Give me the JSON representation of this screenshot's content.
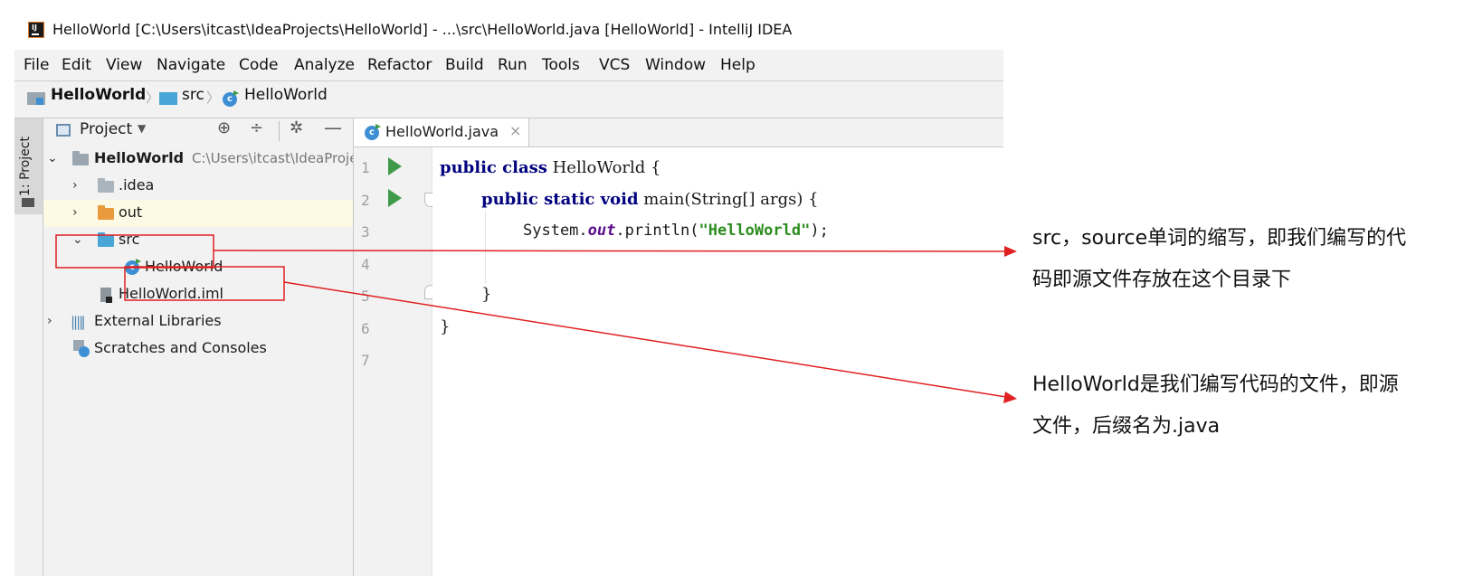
{
  "window": {
    "title": "HelloWorld [C:\\Users\\itcast\\IdeaProjects\\HelloWorld] - ...\\src\\HelloWorld.java [HelloWorld] - IntelliJ IDEA"
  },
  "menu": [
    "File",
    "Edit",
    "View",
    "Navigate",
    "Code",
    "Analyze",
    "Refactor",
    "Build",
    "Run",
    "Tools",
    "VCS",
    "Window",
    "Help"
  ],
  "breadcrumb": {
    "project": "HelloWorld",
    "folder": "src",
    "file": "HelloWorld"
  },
  "sidebar": {
    "tab_label": "1: Project"
  },
  "project_panel": {
    "title": "Project",
    "tree": {
      "root_name": "HelloWorld",
      "root_path": "C:\\Users\\itcast\\IdeaProjects\\HelloWorld",
      "idea": ".idea",
      "out": "out",
      "src": "src",
      "class_file": "HelloWorld",
      "iml": "HelloWorld.iml",
      "ext_libs": "External Libraries",
      "scratches": "Scratches and Consoles"
    }
  },
  "editor": {
    "tab_label": "HelloWorld.java",
    "line_numbers": [
      "1",
      "2",
      "3",
      "4",
      "5",
      "6",
      "7"
    ],
    "code": {
      "l1_kw": "public class",
      "l1_rest": " HelloWorld {",
      "l2_kw": "public static void",
      "l2_rest": " main(String[] args) {",
      "l3_a": "System.",
      "l3_field": "out",
      "l3_b": ".println(",
      "l3_str": "\"HelloWorld\"",
      "l3_c": ");",
      "l5": "}",
      "l6": "}"
    }
  },
  "annotations": {
    "src_line1": "src，source单词的缩写，即我们编写的代",
    "src_line2": "码即源文件存放在这个目录下",
    "file_line1": " HelloWorld是我们编写代码的文件，即源",
    "file_line2": "文件，后缀名为.java"
  },
  "colors": {
    "highlight_box": "#e02020",
    "arrow": "#e02020",
    "keyword": "#00007f",
    "string": "#2d8c1f",
    "run_icon": "#3f9b49"
  }
}
